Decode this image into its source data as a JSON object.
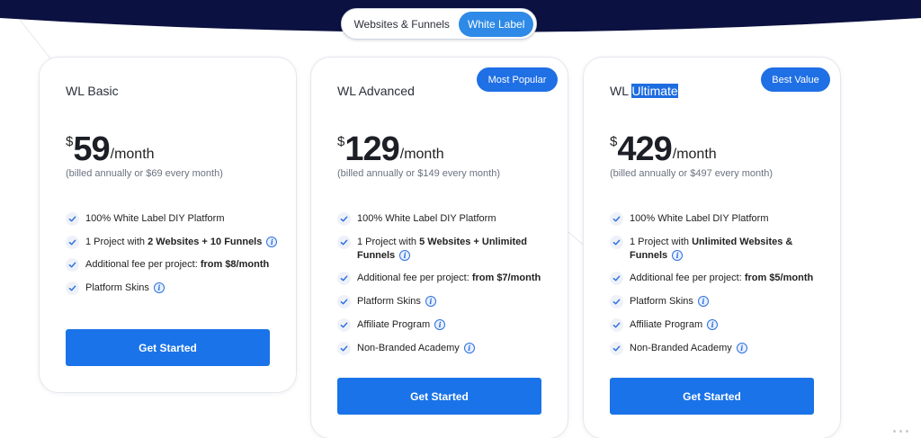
{
  "toggle": {
    "options": [
      "Websites & Funnels",
      "White Label"
    ],
    "selected": "White Label"
  },
  "colors": {
    "header_navy": "#0b1140",
    "accent_blue": "#1a73e8",
    "toggle_active": "#2e8ae6"
  },
  "plans": [
    {
      "name_prefix": "WL Basic",
      "name_highlight": "",
      "badge": "",
      "currency": "$",
      "amount": "59",
      "period": "/month",
      "billed": "(billed annually or $69 every month)",
      "features": [
        {
          "pre": "100% White Label DIY Platform",
          "bold": "",
          "post": "",
          "info": false
        },
        {
          "pre": "1 Project with ",
          "bold": "2 Websites + 10 Funnels",
          "post": "",
          "info": true
        },
        {
          "pre": "Additional fee per project: ",
          "bold": "from $8/month",
          "post": "",
          "info": false
        },
        {
          "pre": "Platform Skins",
          "bold": "",
          "post": "",
          "info": true
        }
      ],
      "cta": "Get Started"
    },
    {
      "name_prefix": "WL Advanced",
      "name_highlight": "",
      "badge": "Most Popular",
      "currency": "$",
      "amount": "129",
      "period": "/month",
      "billed": "(billed annually or $149 every month)",
      "features": [
        {
          "pre": "100% White Label DIY Platform",
          "bold": "",
          "post": "",
          "info": false
        },
        {
          "pre": "1 Project with ",
          "bold": "5 Websites + Unlimited Funnels",
          "post": "",
          "info": true
        },
        {
          "pre": "Additional fee per project: ",
          "bold": "from $7/month",
          "post": "",
          "info": false
        },
        {
          "pre": "Platform Skins",
          "bold": "",
          "post": "",
          "info": true
        },
        {
          "pre": "Affiliate Program",
          "bold": "",
          "post": "",
          "info": true
        },
        {
          "pre": "Non-Branded Academy",
          "bold": "",
          "post": "",
          "info": true
        }
      ],
      "cta": "Get Started"
    },
    {
      "name_prefix": "WL ",
      "name_highlight": "Ultimate",
      "badge": "Best Value",
      "currency": "$",
      "amount": "429",
      "period": "/month",
      "billed": "(billed annually or $497 every month)",
      "features": [
        {
          "pre": "100% White Label DIY Platform",
          "bold": "",
          "post": "",
          "info": false
        },
        {
          "pre": "1 Project with ",
          "bold": "Unlimited Websites & Funnels",
          "post": "",
          "info": true
        },
        {
          "pre": "Additional fee per project: ",
          "bold": "from $5/month",
          "post": "",
          "info": false
        },
        {
          "pre": "Platform Skins",
          "bold": "",
          "post": "",
          "info": true
        },
        {
          "pre": "Affiliate Program",
          "bold": "",
          "post": "",
          "info": true
        },
        {
          "pre": "Non-Branded Academy",
          "bold": "",
          "post": "",
          "info": true
        }
      ],
      "cta": "Get Started"
    }
  ]
}
